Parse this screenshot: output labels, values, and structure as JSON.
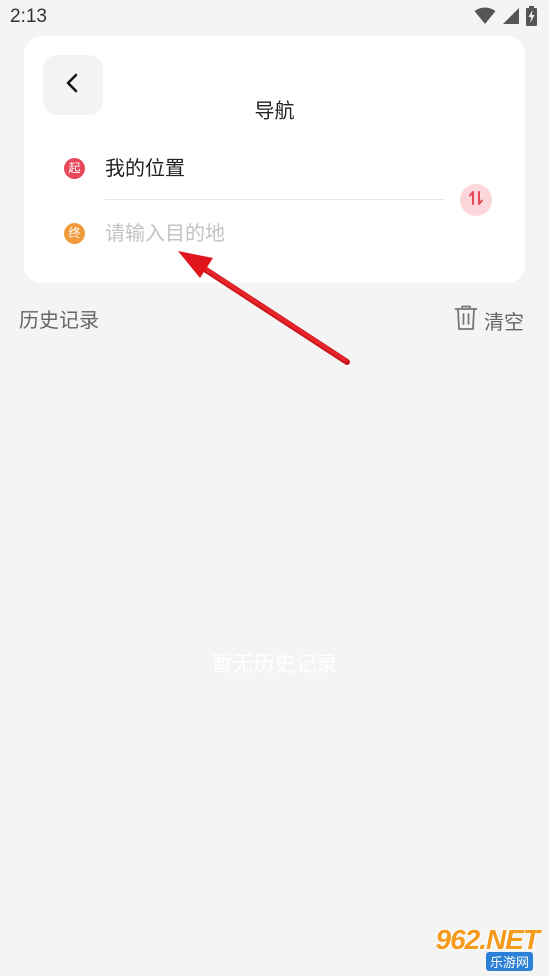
{
  "status_bar": {
    "time": "2:13"
  },
  "nav": {
    "title": "导航",
    "start_badge": "起",
    "end_badge": "终",
    "start_label": "我的位置",
    "destination_placeholder": "请输入目的地",
    "destination_value": ""
  },
  "history": {
    "title": "历史记录",
    "clear_label": "清空",
    "empty_text": "暂无历史记录"
  },
  "icons": {
    "back": "chevron-left-icon",
    "swap": "swap-icon",
    "trash": "trash-icon",
    "wifi": "wifi-icon",
    "signal": "signal-icon",
    "battery": "battery-charging-icon"
  },
  "colors": {
    "start_badge": "#e8495a",
    "end_badge": "#ef9a3c",
    "swap_accent": "#e8495a",
    "annotation_arrow": "#e0141b"
  },
  "watermark": {
    "main": "962.NET",
    "sub": "乐游网"
  }
}
